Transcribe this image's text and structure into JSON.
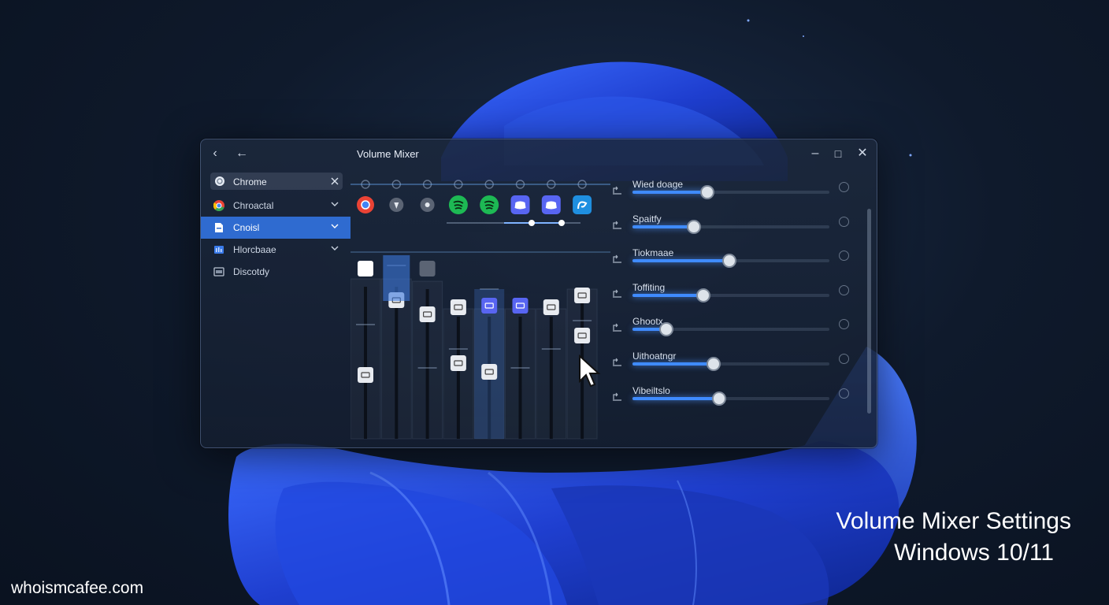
{
  "window": {
    "title": "Volume Mixer",
    "controls": [
      "minimize-icon",
      "maximize-icon",
      "close-icon"
    ]
  },
  "sidebar": {
    "search_value": "Chrome",
    "items": [
      {
        "label": "Chroactal",
        "icon": "chrome-icon"
      },
      {
        "label": "Cnoisl",
        "icon": "document-icon",
        "selected": true
      },
      {
        "label": "Hlorcbaae",
        "icon": "bar-icon"
      },
      {
        "label": "Discotdy",
        "icon": "window-icon"
      }
    ]
  },
  "mixer": {
    "app_icons": [
      "chrome-icon",
      "shield-icon",
      "gamepad-icon",
      "spotify-icon",
      "spotify-icon",
      "discord-icon",
      "discord-icon",
      "edge-icon"
    ],
    "channels": 8
  },
  "app_sliders": [
    {
      "label": "Wied doage",
      "level": 0.38
    },
    {
      "label": "Spaitfy",
      "level": 0.31
    },
    {
      "label": "Tiokmaae",
      "level": 0.49
    },
    {
      "label": "Toffiting",
      "level": 0.36
    },
    {
      "label": "Ghootx",
      "level": 0.17
    },
    {
      "label": "Uithoatngr",
      "level": 0.41
    },
    {
      "label": "Vibeiltslo",
      "level": 0.44
    }
  ],
  "caption": {
    "line1": "Volume Mixer Settings",
    "line2": "Windows 10/11"
  },
  "brand": "whoismcafee.com",
  "colors": {
    "accent": "#2f6bd0",
    "slider_fill": "#3f8bff",
    "wallpaper_blue": "#2349d8",
    "spotify": "#1db954",
    "discord": "#5865f2"
  }
}
